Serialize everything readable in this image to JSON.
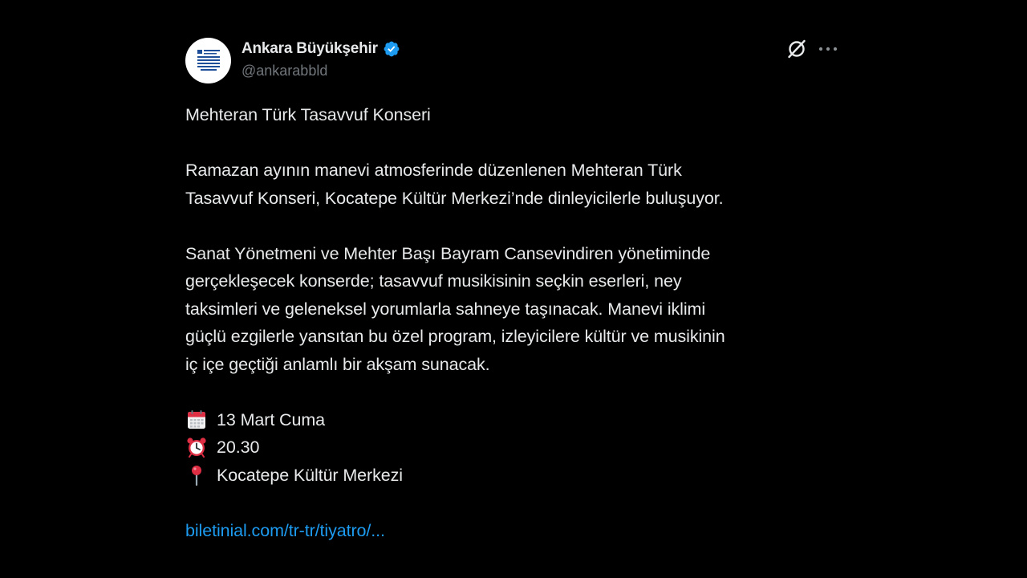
{
  "author": {
    "display_name": "Ankara Büyükşehir",
    "handle": "@ankarabbld",
    "verified": true,
    "avatar_icon": "ankara-municipality-logo-icon",
    "verified_icon": "verified-badge-icon"
  },
  "header_actions": {
    "grok_icon": "grok-icon",
    "more_icon": "more-horizontal-icon"
  },
  "tweet": {
    "title": "Mehteran Türk Tasavvuf Konseri",
    "paragraph1": [
      "Ramazan ayının manevi atmosferinde düzenlenen Mehteran Türk",
      "Tasavvuf Konseri, Kocatepe Kültür Merkezi’nde dinleyicilerle buluşuyor."
    ],
    "paragraph2": [
      "Sanat Yönetmeni ve Mehter Başı Bayram Cansevindiren yönetiminde",
      "gerçekleşecek konserde; tasavvuf musikisinin seçkin eserleri, ney",
      "taksimleri ve geleneksel yorumlarla sahneye taşınacak. Manevi iklimi",
      "güçlü ezgilerle yansıtan bu özel program, izleyicilere kültür ve musikinin",
      "iç içe geçtiği anlamlı bir akşam sunacak."
    ],
    "details": {
      "date": "13 Mart Cuma",
      "date_icon": "calendar-icon",
      "time": "20.30",
      "time_icon": "alarm-clock-icon",
      "location": "Kocatepe Kültür Merkezi",
      "location_icon": "round-pushpin-icon"
    },
    "link": "biletinial.com/tr-tr/tiyatro/..."
  },
  "colors": {
    "background": "#000000",
    "text": "#e7e9ea",
    "secondary_text": "#71767b",
    "link": "#1d9bf0",
    "verified": "#1d9bf0"
  }
}
